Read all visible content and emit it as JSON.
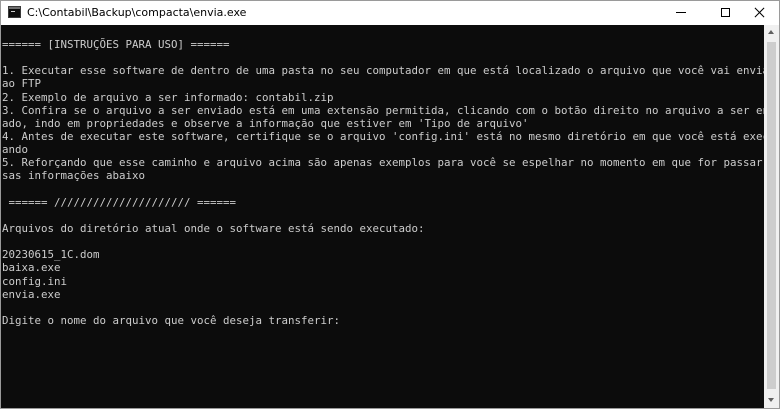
{
  "window": {
    "title": "C:\\Contabil\\Backup\\compacta\\envia.exe",
    "icon": "console-app-icon",
    "controls": [
      "minimize-icon",
      "maximize-icon",
      "close-icon"
    ]
  },
  "console": {
    "background": "#0c0c0c",
    "foreground": "#cccccc",
    "lines": [
      "====== [INSTRUÇÕES PARA USO] ======",
      "",
      "1. Executar esse software de dentro de uma pasta no seu computador em que está localizado o arquivo que você vai enviar",
      "ao FTP",
      "2. Exemplo de arquivo a ser informado: contabil.zip",
      "3. Confira se o arquivo a ser enviado está em uma extensão permitida, clicando com o botão direito no arquivo a ser envi",
      "ado, indo em propriedades e observe a informação que estiver em 'Tipo de arquivo'",
      "4. Antes de executar este software, certifique se o arquivo 'config.ini' está no mesmo diretório em que você está execut",
      "ando",
      "5. Reforçando que esse caminho e arquivo acima são apenas exemplos para você se espelhar no momento em que for passar es",
      "sas informações abaixo",
      "",
      " ====== ///////////////////// ======",
      "",
      "Arquivos do diretório atual onde o software está sendo executado:",
      "",
      "20230615_1C.dom",
      "baixa.exe",
      "config.ini",
      "envia.exe",
      "",
      "Digite o nome do arquivo que você deseja transferir:"
    ]
  }
}
